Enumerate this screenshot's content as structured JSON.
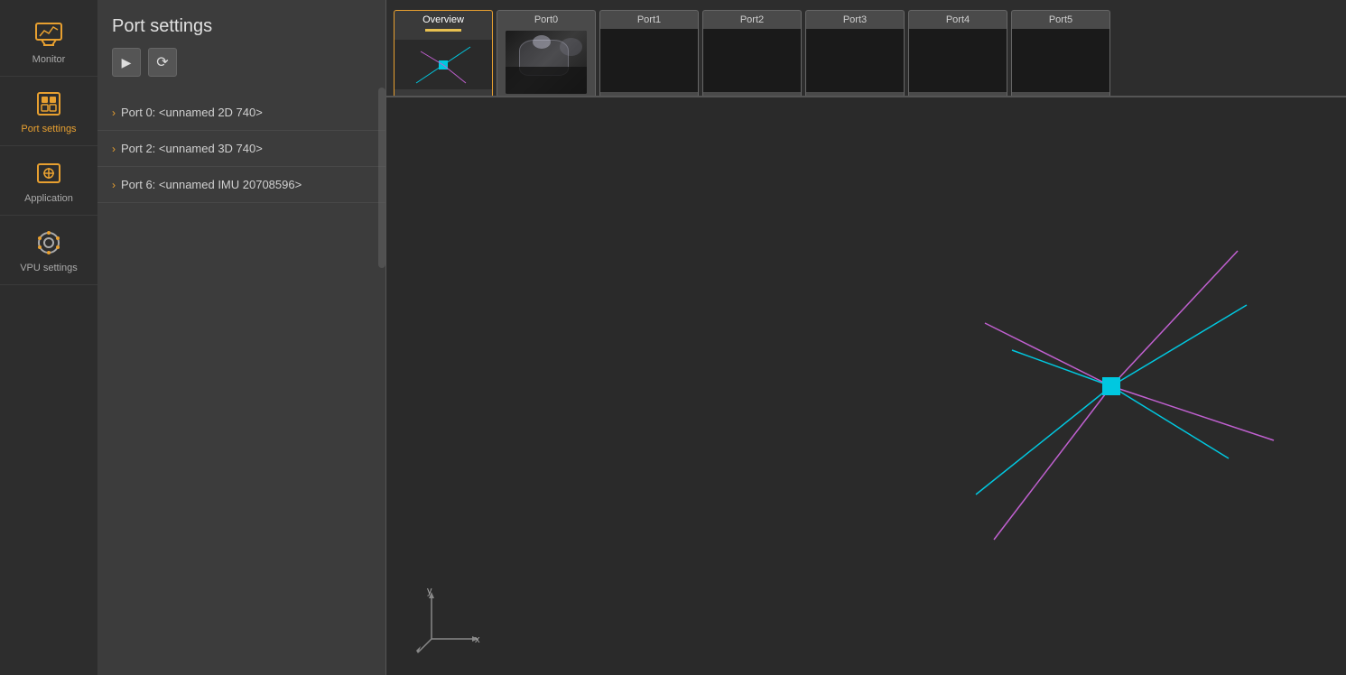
{
  "sidebar": {
    "items": [
      {
        "id": "monitor",
        "label": "Monitor",
        "active": false
      },
      {
        "id": "port-settings",
        "label": "Port settings",
        "active": true
      },
      {
        "id": "application",
        "label": "Application",
        "active": false
      },
      {
        "id": "vpu-settings",
        "label": "VPU settings",
        "active": false
      }
    ]
  },
  "panel": {
    "title": "Port settings",
    "toolbar": {
      "play_label": "▶",
      "refresh_label": "⟳"
    },
    "ports": [
      {
        "id": "port0",
        "label": "Port 0: <unnamed 2D 740>"
      },
      {
        "id": "port2",
        "label": "Port 2: <unnamed 3D 740>"
      },
      {
        "id": "port6",
        "label": "Port 6: <unnamed IMU 20708596>"
      }
    ]
  },
  "tabs": [
    {
      "id": "overview",
      "label": "Overview",
      "active": true,
      "has_indicator": true
    },
    {
      "id": "port0",
      "label": "Port0",
      "active": false,
      "has_camera": true
    },
    {
      "id": "port1",
      "label": "Port1",
      "active": false
    },
    {
      "id": "port2",
      "label": "Port2",
      "active": false
    },
    {
      "id": "port3",
      "label": "Port3",
      "active": false
    },
    {
      "id": "port4",
      "label": "Port4",
      "active": false
    },
    {
      "id": "port5",
      "label": "Port5",
      "active": false
    }
  ],
  "colors": {
    "accent": "#e8a030",
    "indicator": "#e8c050",
    "active_border": "#e8a030",
    "background": "#2a2a2a",
    "sidebar_bg": "#2d2d2d",
    "panel_bg": "#3c3c3c",
    "viz_cyan": "#00c8e0",
    "viz_magenta": "#c060d0"
  },
  "viewport": {
    "axis_x_label": "x",
    "axis_y_label": "y"
  }
}
